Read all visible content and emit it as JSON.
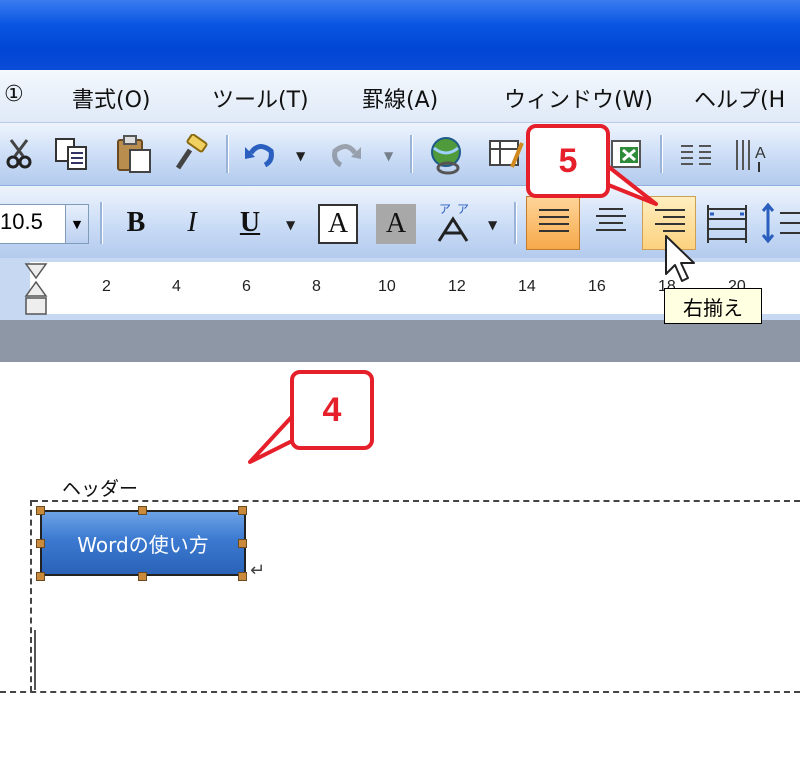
{
  "menu": {
    "items": [
      {
        "label": "①"
      },
      {
        "label": "書式(O)"
      },
      {
        "label": "ツール(T)"
      },
      {
        "label": "罫線(A)"
      },
      {
        "label": "ウィンドウ(W)"
      },
      {
        "label": "ヘルプ(H"
      }
    ]
  },
  "toolbar": {
    "font_size": "10.5",
    "bold_label": "B",
    "italic_label": "I",
    "underline_label": "U",
    "char_border_label": "A",
    "char_shade_label": "A"
  },
  "ruler": {
    "ticks": [
      "2",
      "4",
      "6",
      "8",
      "10",
      "12",
      "14",
      "16",
      "18",
      "20"
    ]
  },
  "tooltip": {
    "text": "右揃え"
  },
  "document": {
    "header_label": "ヘッダー",
    "button_text": "Wordの使い方",
    "pilcrow": "↵"
  },
  "callouts": {
    "step4": "4",
    "step5": "5"
  },
  "colors": {
    "callout": "#e5202a",
    "title_bar": "#0a56e2",
    "active_button": "#f6a94a"
  }
}
